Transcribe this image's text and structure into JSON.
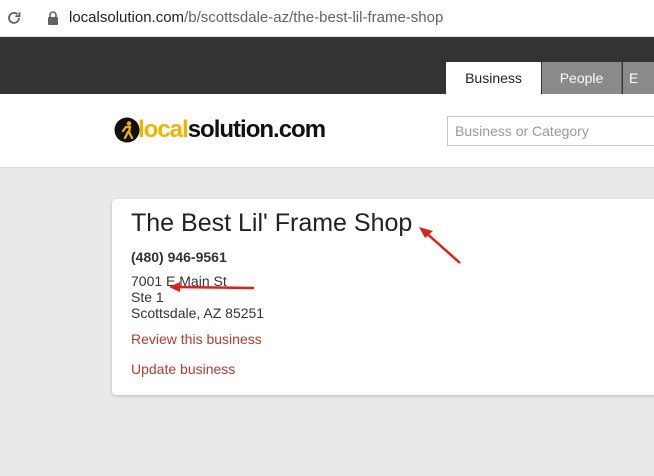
{
  "browser": {
    "url_host": "localsolution.com",
    "url_path": "/b/scottsdale-az/the-best-lil-frame-shop",
    "icons": [
      "reload-icon",
      "lock-icon"
    ]
  },
  "nav": {
    "tabs": [
      {
        "label": "Business",
        "active": true
      },
      {
        "label": "People",
        "active": false
      },
      {
        "label": "E",
        "active": false
      }
    ]
  },
  "header": {
    "logo_local": "local",
    "logo_rest": "solution.com",
    "search_placeholder": "Business or Category"
  },
  "business": {
    "name": "The Best Lil' Frame Shop",
    "phone": "(480) 946-9561",
    "address_line1": "7001 E Main St",
    "address_line2": "Ste 1",
    "address_line3": "Scottsdale, AZ 85251",
    "review_link": "Review this business",
    "update_link": "Update business"
  },
  "colors": {
    "nav_bg": "#333333",
    "link": "#b53a2c",
    "logo_accent": "#f3b400",
    "annotation_arrow": "#e0201a"
  }
}
